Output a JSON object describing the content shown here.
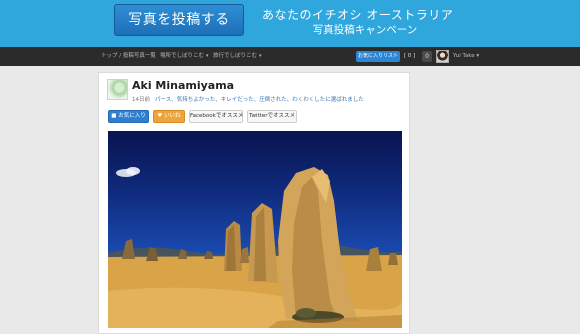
{
  "banner": {
    "post_button": "写真を投稿する",
    "campaign_title": "あなたのイチオシ オーストラリア",
    "campaign_subtitle": "写真投稿キャンペーン"
  },
  "nav": {
    "items": [
      "トップ / 投稿写真一覧",
      "場所でしぼりこむ",
      "旅行でしぼりこむ"
    ],
    "caret": "▾",
    "favorites_button": "お気に入りリスト",
    "favorites_count": "[ 0 ]",
    "notification_count": "0",
    "user_name": "Yui Take ▾"
  },
  "post": {
    "author": "Aki Minamiyama",
    "time": "14日前",
    "caption": "パース、気持ちよかった、キレイだった、圧倒された、わくわくしたに選ばれました",
    "buttons": {
      "favorite": "■ お気に入り",
      "like": "♥ いいね",
      "facebook": "Facebookでオススメ",
      "twitter": "Twitterでオススメ"
    }
  },
  "colors": {
    "banner": "#2fa6dc",
    "navbar": "#2b2b2b",
    "accent_blue": "#2d7fcf",
    "like_orange": "#f0a33a"
  }
}
